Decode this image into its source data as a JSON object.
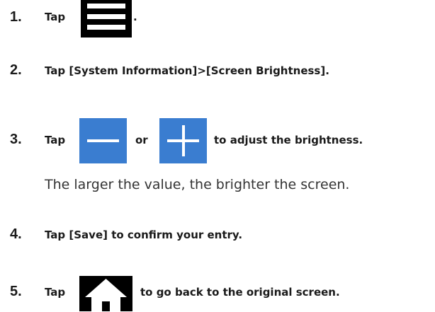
{
  "steps": [
    {
      "number": "1.",
      "text_before": "Tap",
      "text_after": "."
    },
    {
      "number": "2.",
      "text": "Tap [System Information]>[Screen Brightness]."
    },
    {
      "number": "3.",
      "text_before": "Tap",
      "text_middle": "or",
      "text_after": "to adjust the brightness.",
      "note": "The larger the value, the brighter the screen."
    },
    {
      "number": "4.",
      "text": "Tap [Save] to confirm your entry."
    },
    {
      "number": "5.",
      "text_before": "Tap",
      "text_after": "to go back to the original screen."
    }
  ],
  "icons": {
    "menu": "menu-icon",
    "minus": "minus-icon",
    "plus": "plus-icon",
    "home": "home-icon"
  },
  "colors": {
    "icon_blue": "#3a7dd0",
    "icon_black": "#000000",
    "text": "#1a1a1a"
  }
}
